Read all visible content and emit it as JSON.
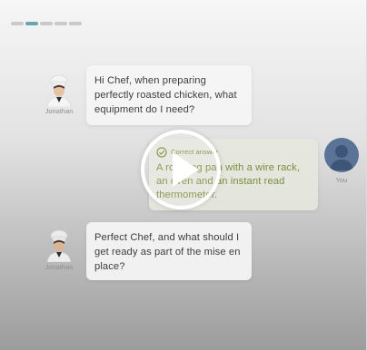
{
  "progress": {
    "segments": 5,
    "active_index": 1
  },
  "messages": [
    {
      "sender": "Jonathan",
      "text": "Hi Chef, when preparing perfectly roasted chicken, what equipment do I need?"
    },
    {
      "sender": "You",
      "status_label": "Correct answer",
      "text": "A roasting pan with a wire rack, an oven and an instant read thermometer."
    },
    {
      "sender": "Jonathan",
      "text": "Perfect Chef, and what should I get ready as part of the mise en place?"
    }
  ],
  "colors": {
    "accent": "#6aa5b3",
    "correct": "#7b8f3f",
    "you_avatar": "#5a7396"
  },
  "icons": {
    "status": "check-circle-icon",
    "player": "play-icon"
  }
}
